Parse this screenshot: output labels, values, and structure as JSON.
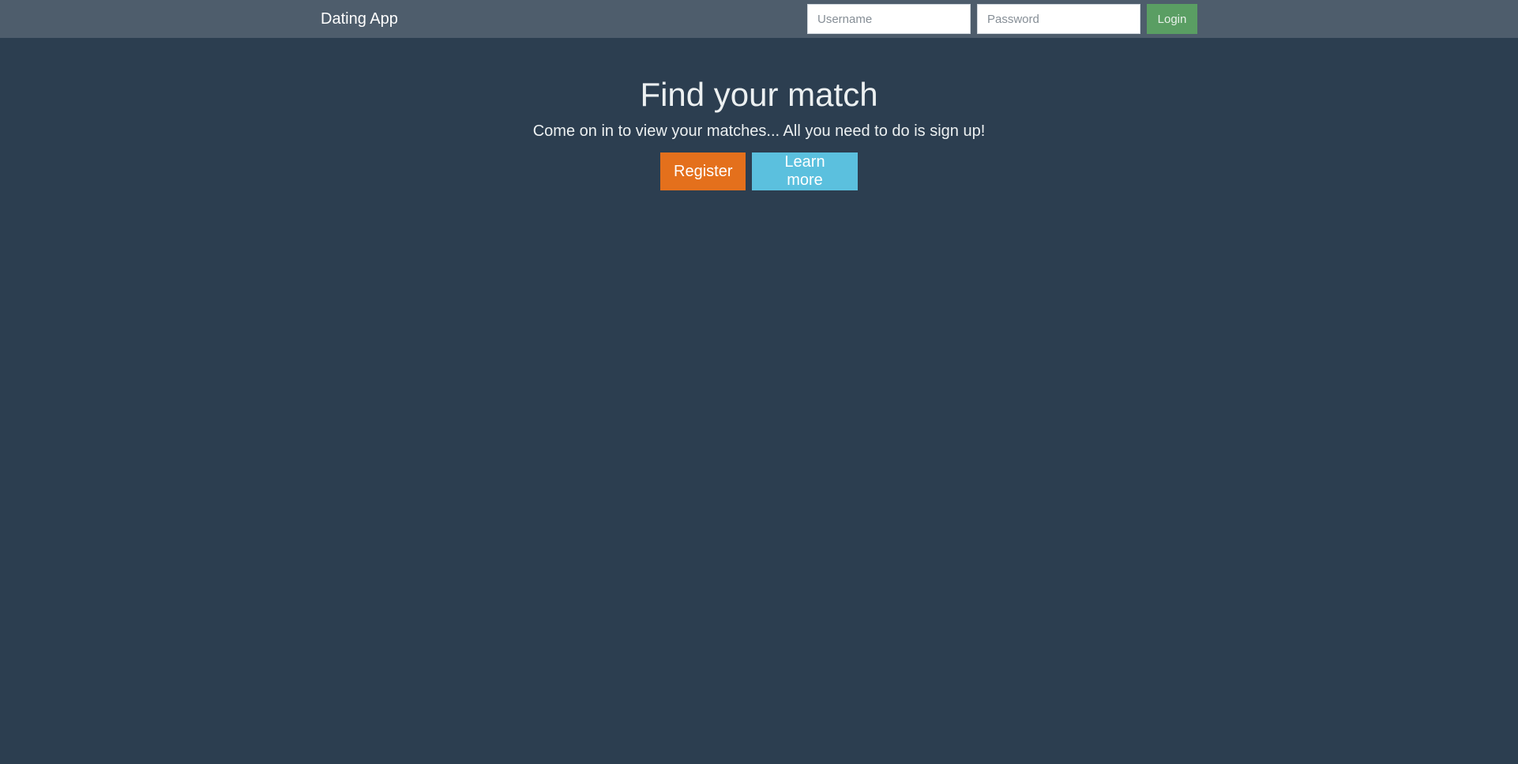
{
  "navbar": {
    "brand": "Dating App",
    "username_placeholder": "Username",
    "password_placeholder": "Password",
    "login_label": "Login"
  },
  "hero": {
    "title": "Find your match",
    "subtitle": "Come on in to view your matches... All you need to do is sign up!",
    "register_label": "Register",
    "learn_more_label": "Learn more"
  },
  "colors": {
    "background": "#2c3e50",
    "navbar": "#4e5d6c",
    "login_button": "#5a9e63",
    "register_button": "#e4701c",
    "learn_more_button": "#5bc0de"
  }
}
